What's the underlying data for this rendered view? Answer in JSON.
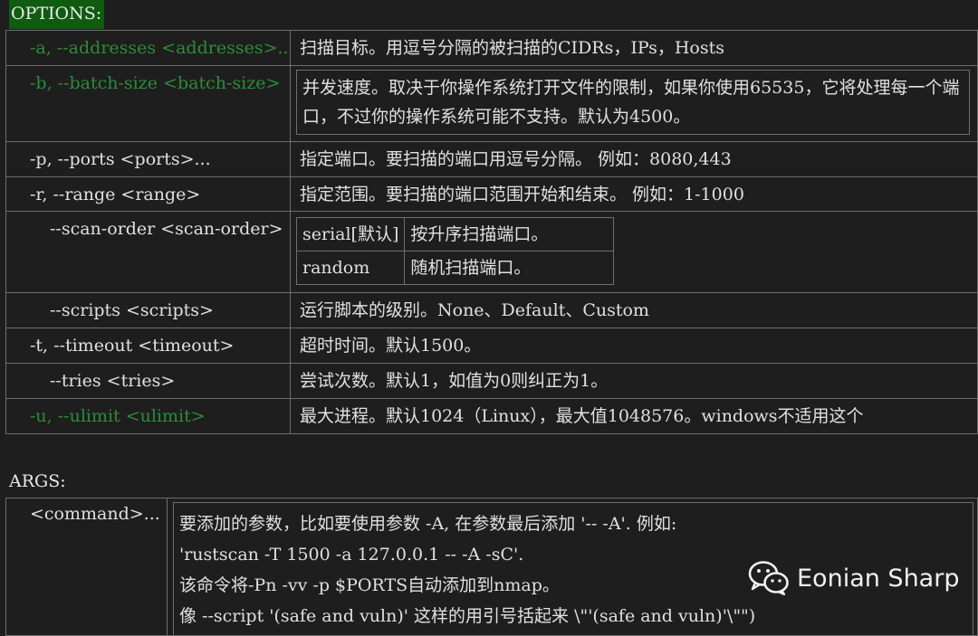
{
  "options_label": "OPTIONS:",
  "args_label": "ARGS:",
  "options": {
    "addresses": {
      "flag": "-a, --addresses <addresses>...",
      "desc": "扫描目标。用逗号分隔的被扫描的CIDRs，IPs，Hosts"
    },
    "batch": {
      "flag": "-b, --batch-size <batch-size>",
      "desc": "并发速度。取决于你操作系统打开文件的限制，如果你使用65535，它将处理每一个端口，不过你的操作系统可能不支持。默认为4500。"
    },
    "ports": {
      "flag": "-p, --ports <ports>...",
      "desc": "指定端口。要扫描的端口用逗号分隔。 例如：8080,443"
    },
    "range": {
      "flag": "-r, --range <range>",
      "desc": "指定范围。要扫描的端口范围开始和结束。 例如：1-1000"
    },
    "scan_order": {
      "flag": "--scan-order <scan-order>",
      "rows": [
        {
          "value": "serial[默认]",
          "desc": "按升序扫描端口。"
        },
        {
          "value": "random",
          "desc": "随机扫描端口。"
        }
      ]
    },
    "scripts": {
      "flag": "--scripts <scripts>",
      "desc": "运行脚本的级别。None、Default、Custom"
    },
    "timeout": {
      "flag": "-t, --timeout <timeout>",
      "desc": "超时时间。默认1500。"
    },
    "tries": {
      "flag": "--tries <tries>",
      "desc": "尝试次数。默认1，如值为0则纠正为1。"
    },
    "ulimit": {
      "flag": "-u, --ulimit <ulimit>",
      "desc": "最大进程。默认1024（Linux），最大值1048576。windows不适用这个"
    }
  },
  "args": {
    "flag": "<command>...",
    "lines": [
      "要添加的参数，比如要使用参数 -A, 在参数最后添加 '-- -A'. 例如:",
      "'rustscan -T 1500 -a 127.0.0.1 -- -A -sC'.",
      "该命令将-Pn -vv -p $PORTS自动添加到nmap。",
      "像 --script '(safe and vuln)' 这样的用引号括起来 \\\"'(safe and vuln)'\\\"\")"
    ]
  },
  "watermark": {
    "text": "Eonian Sharp",
    "icon": "wechat-icon"
  },
  "colors": {
    "green_flag": "#2e8b3a",
    "options_label_bg": "#0f5b10",
    "background": "#1e1e1e"
  }
}
